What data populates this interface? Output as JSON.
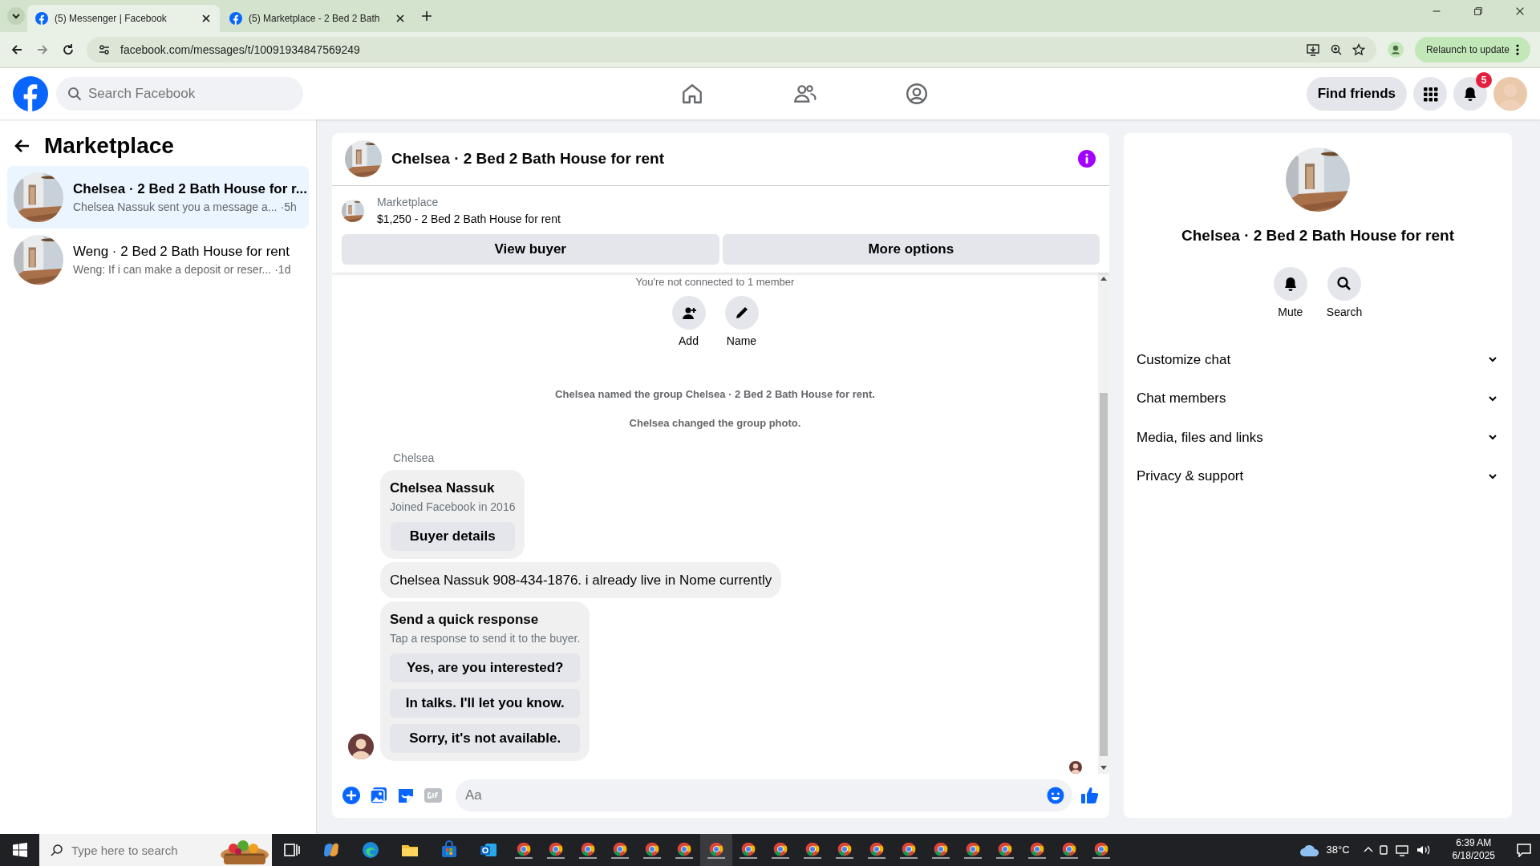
{
  "browser": {
    "tabs": [
      {
        "title": "(5) Messenger | Facebook",
        "selected": true
      },
      {
        "title": "(5) Marketplace - 2 Bed 2 Bath",
        "selected": false
      }
    ],
    "url": "facebook.com/messages/t/10091934847569249",
    "update_button": "Relaunch to update"
  },
  "header": {
    "search_placeholder": "Search Facebook",
    "find_friends": "Find friends",
    "notification_count": "5"
  },
  "sidebar": {
    "title": "Marketplace",
    "conversations": [
      {
        "title": "Chelsea · 2 Bed 2 Bath House for r...",
        "preview": "Chelsea Nassuk sent you a message a...",
        "time": "·5h",
        "selected": true
      },
      {
        "title": "Weng · 2 Bed 2 Bath House for rent",
        "preview": "Weng: If i can make a deposit or reser...",
        "time": "·1d",
        "selected": false
      }
    ]
  },
  "chat": {
    "title": "Chelsea · 2 Bed 2 Bath House for rent",
    "listing": {
      "source": "Marketplace",
      "title": "$1,250 - 2 Bed 2 Bath House for rent"
    },
    "actions": [
      "View buyer",
      "More options"
    ],
    "connection_note": "You're not connected to 1 member",
    "group_actions": [
      {
        "kind": "add",
        "label": "Add"
      },
      {
        "kind": "name",
        "label": "Name"
      }
    ],
    "events": [
      "Chelsea named the group Chelsea · 2 Bed 2 Bath House for rent.",
      "Chelsea changed the group photo."
    ],
    "sender": "Chelsea",
    "buyer_card": {
      "name": "Chelsea Nassuk",
      "joined": "Joined Facebook in 2016",
      "button": "Buyer details"
    },
    "message": "Chelsea Nassuk 908-434-1876. i already live in Nome currently",
    "quick_response": {
      "title": "Send a quick response",
      "subtitle": "Tap a response to send it to the buyer.",
      "options": [
        "Yes, are you interested?",
        "In talks. I'll let you know.",
        "Sorry, it's not available."
      ]
    },
    "composer": {
      "placeholder": "Aa"
    }
  },
  "details": {
    "title": "Chelsea · 2 Bed 2 Bath House for rent",
    "actions": [
      {
        "kind": "mute",
        "label": "Mute"
      },
      {
        "kind": "search",
        "label": "Search"
      }
    ],
    "sections": [
      "Customize chat",
      "Chat members",
      "Media, files and links",
      "Privacy & support"
    ]
  },
  "taskbar": {
    "search_placeholder": "Type here to search",
    "weather": "38°C",
    "time": "6:39 AM",
    "date": "6/18/2025"
  }
}
